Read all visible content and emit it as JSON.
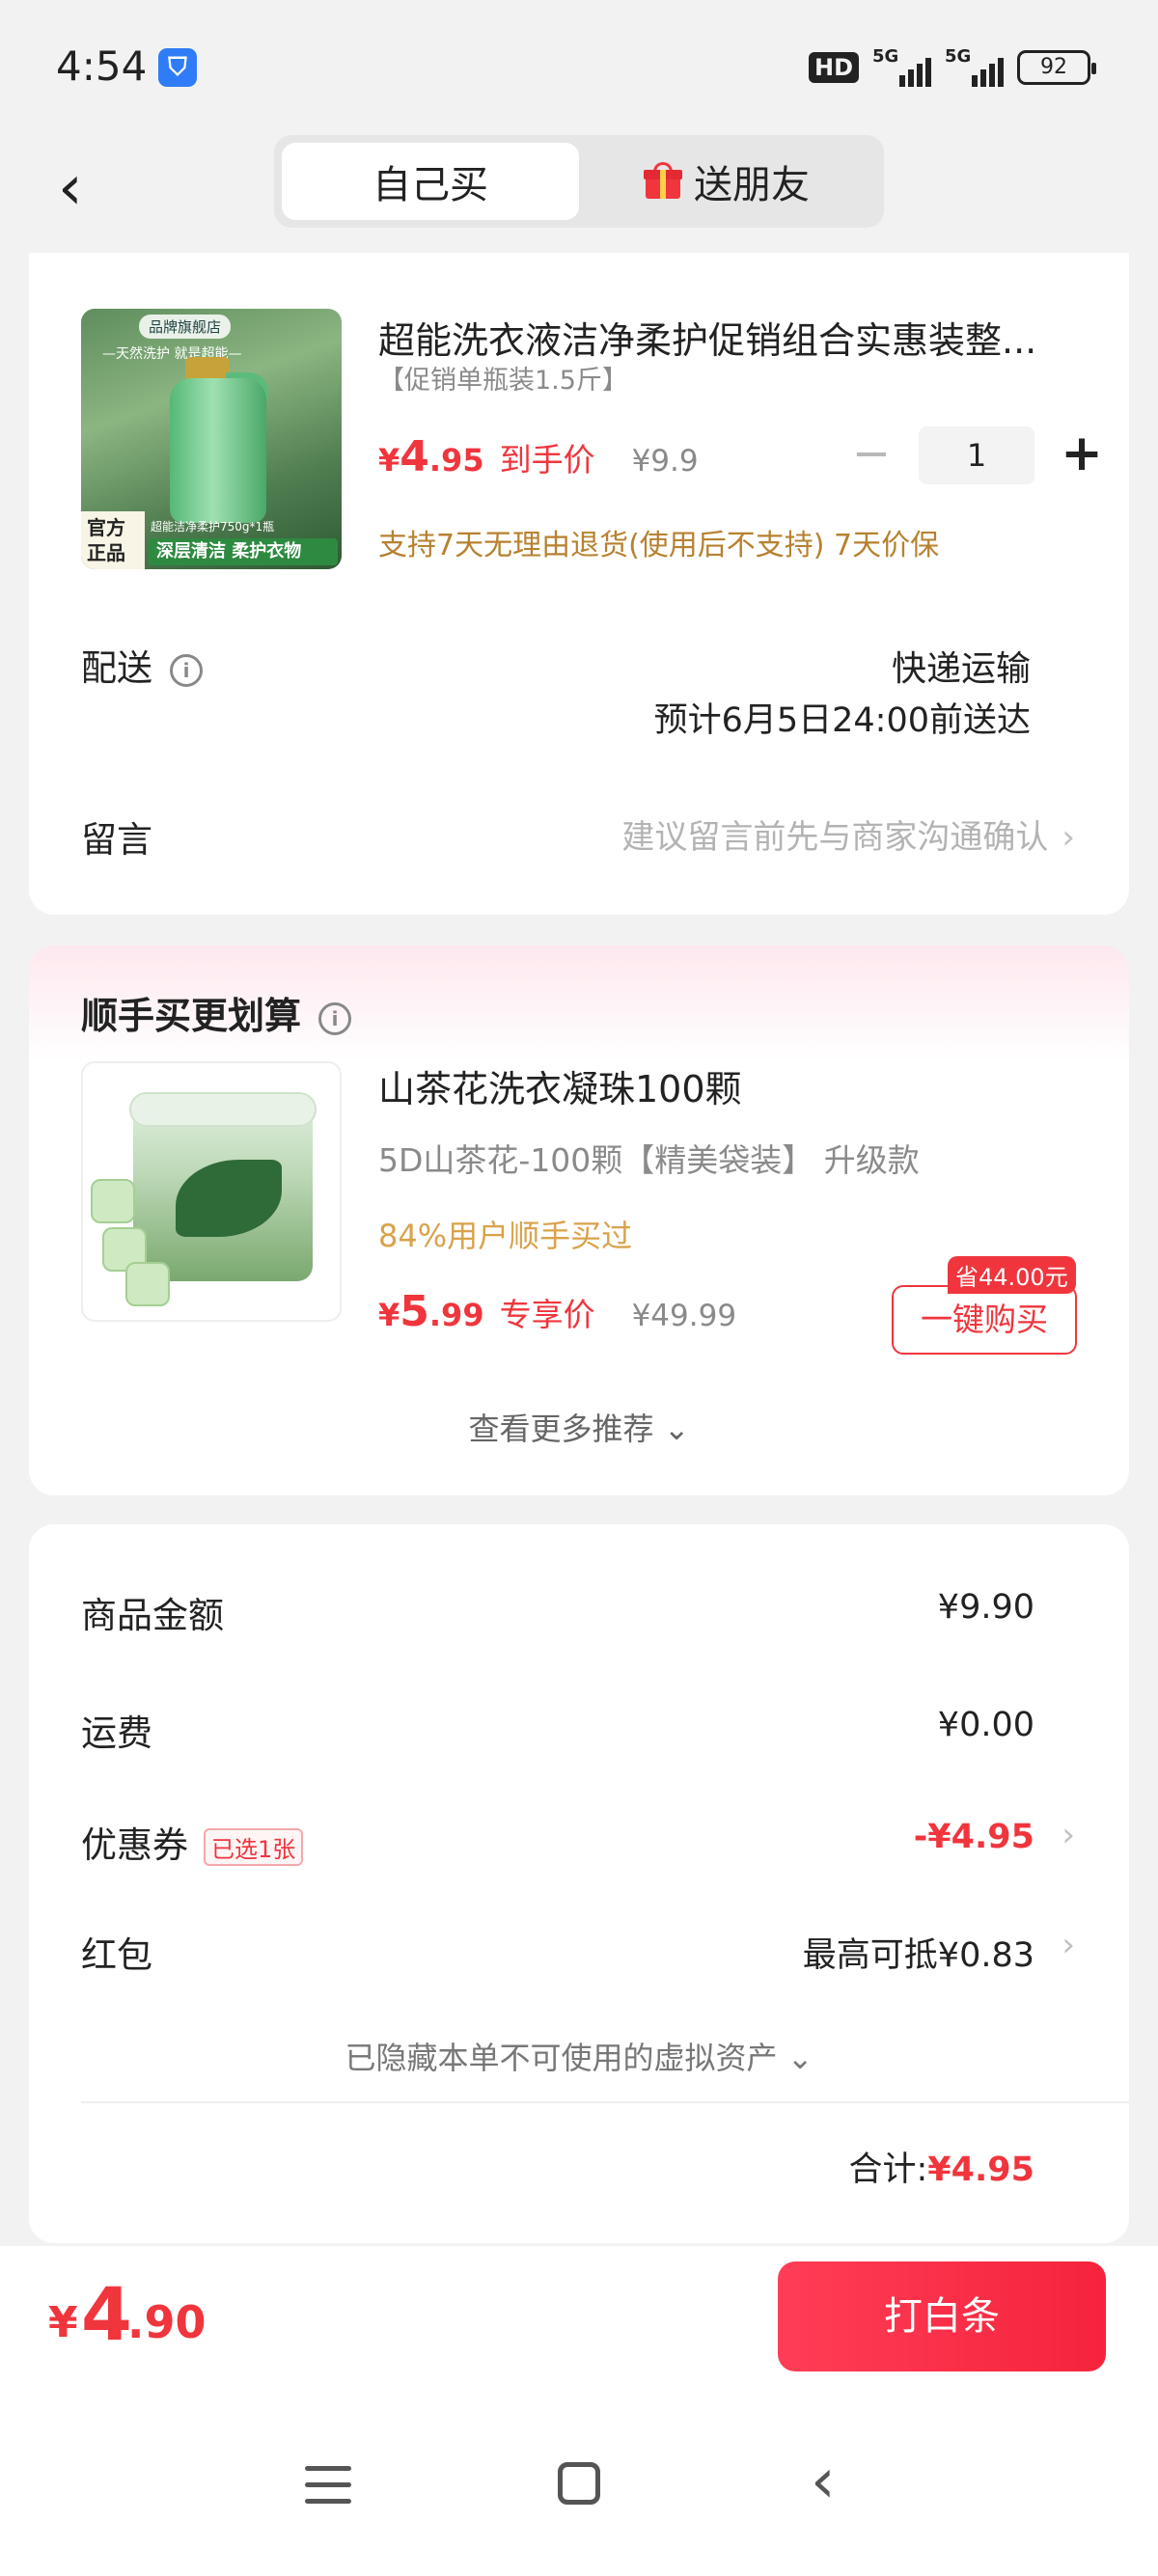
{
  "status_bar": {
    "time": "4:54",
    "app_icon": "shield-app-icon",
    "hd": "HD",
    "net1": "5G",
    "net2": "5G",
    "battery": "92"
  },
  "header": {
    "back_icon": "chevron-left-icon",
    "tabs": [
      {
        "label": "自己买",
        "active": true
      },
      {
        "label": "送朋友",
        "active": false,
        "icon": "gift-icon"
      }
    ]
  },
  "product": {
    "title": "超能洗衣液洁净柔护促销组合实惠装整...",
    "sku": "【促销单瓶装1.5斤】",
    "price_yen": "¥",
    "price_int": "4",
    "price_dec": ".95",
    "price_tag": "到手价",
    "orig_price": "¥9.9",
    "quantity": "1",
    "minus": "−",
    "plus": "+",
    "guarantee": "支持7天无理由退货(使用后不支持) 7天价保",
    "image_text": {
      "shop": "品牌旗舰店",
      "slogan": "—天然洗护 就是超能—",
      "official": "官方正品",
      "spec": "超能洁净柔护750g*1瓶",
      "band": "深层清洁 柔护衣物"
    }
  },
  "delivery": {
    "label": "配送",
    "method": "快递运输",
    "eta": "预计6月5日24:00前送达"
  },
  "note": {
    "label": "留言",
    "placeholder": "建议留言前先与商家沟通确认"
  },
  "recommend": {
    "title": "顺手买更划算",
    "name": "山茶花洗衣凝珠100颗",
    "spec": "5D山茶花-100颗【精美袋装】  升级款",
    "bought": "84%用户顺手买过",
    "price_yen": "¥",
    "price_int": "5",
    "price_dec": ".99",
    "price_tag": "专享价",
    "orig_price": "¥49.99",
    "save_badge": "省44.00元",
    "buy_label": "一键购买",
    "more_label": "查看更多推荐"
  },
  "summary": {
    "goods_label": "商品金额",
    "goods_value": "¥9.90",
    "freight_label": "运费",
    "freight_value": "¥0.00",
    "coupon_label": "优惠券",
    "coupon_badge": "已选1张",
    "coupon_value": "-¥4.95",
    "redpacket_label": "红包",
    "redpacket_value": "最高可抵¥0.83",
    "hidden_assets": "已隐藏本单不可使用的虚拟资产",
    "total_label": "合计:",
    "total_value": "¥4.95"
  },
  "bottom_bar": {
    "yen": "¥",
    "int": "4",
    "dec": ".90",
    "pay_label": "打白条"
  },
  "colors": {
    "accent": "#f0353d",
    "gold": "#b7812f",
    "muted": "#8a8a8a"
  }
}
